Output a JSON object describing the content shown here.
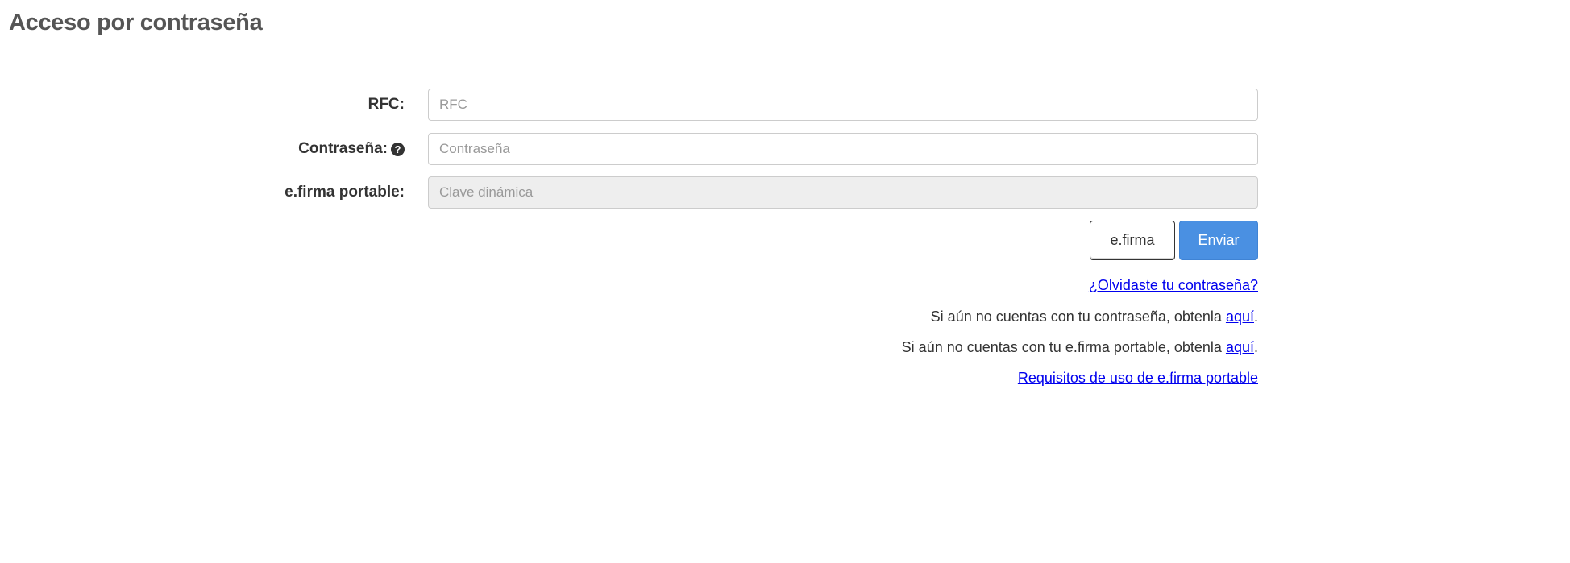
{
  "header": {
    "title": "Acceso por contraseña"
  },
  "form": {
    "rfc": {
      "label": "RFC:",
      "placeholder": "RFC",
      "value": ""
    },
    "password": {
      "label": "Contraseña:",
      "placeholder": "Contraseña",
      "value": "",
      "help_icon": "question-circle-icon"
    },
    "efirma_portable": {
      "label": "e.firma portable:",
      "placeholder": "Clave dinámica",
      "value": "",
      "disabled": true
    }
  },
  "buttons": {
    "efirma_label": "e.firma",
    "enviar_label": "Enviar",
    "enviar_color": "#4a90e2"
  },
  "links": {
    "forgot_password": "¿Olvidaste tu contraseña?",
    "get_password_text": "Si aún no cuentas con tu contraseña, obtenla ",
    "get_password_link": "aquí",
    "get_efirma_text": "Si aún no cuentas con tu e.firma portable, obtenla ",
    "get_efirma_link": "aquí",
    "period": ".",
    "requirements": "Requisitos de uso de e.firma portable"
  }
}
